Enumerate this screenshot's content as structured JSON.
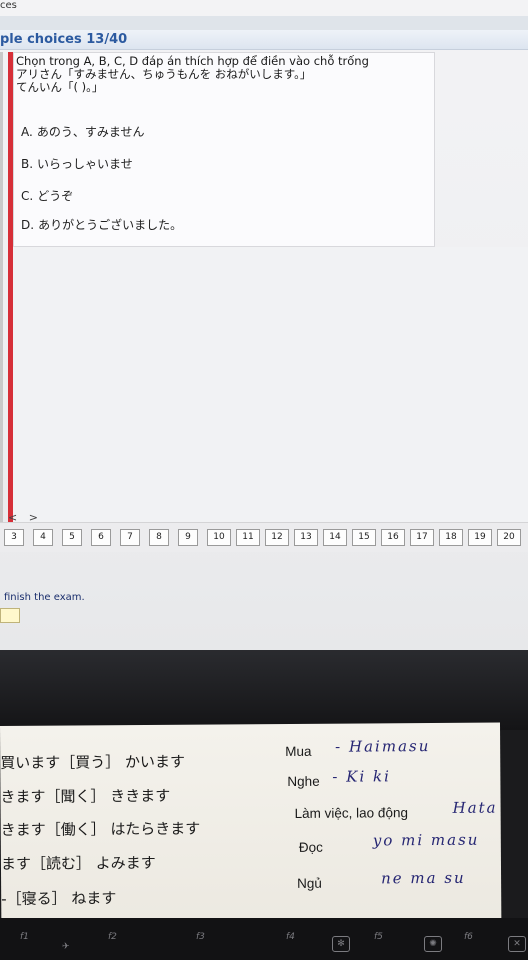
{
  "browser": {
    "tab_fragment": "ces"
  },
  "header": {
    "title": "ple choices 13/40"
  },
  "question": {
    "prompt": "Chọn trong A, B, C, D đáp án thích hợp để điền vào chỗ trống",
    "line2": "アリさん「すみません、ちゅうもんを おねがいします。」",
    "line3": "てんいん「(        )。」",
    "options": [
      {
        "key": "A.",
        "text": "あのう、すみません"
      },
      {
        "key": "B.",
        "text": "いらっしゃいませ"
      },
      {
        "key": "C.",
        "text": "どうぞ"
      },
      {
        "key": "D.",
        "text": "ありがとうございました。"
      }
    ]
  },
  "nav": {
    "arrows": "< >"
  },
  "pager": {
    "pages": [
      "3",
      "4",
      "5",
      "6",
      "7",
      "8",
      "9",
      "10",
      "11",
      "12",
      "13",
      "14",
      "15",
      "16",
      "17",
      "18",
      "19",
      "20"
    ]
  },
  "footer": {
    "finish_text": "finish the exam."
  },
  "note": {
    "rows": [
      {
        "jp": "買います［買う］ かいます",
        "vn": "Mua",
        "hw": "- Haimasu"
      },
      {
        "jp": "きます［聞く］ ききます",
        "vn": "Nghe",
        "hw": "- Ki ki"
      },
      {
        "jp": "きます［働く］ はたらきます",
        "vn": "Làm việc, lao động",
        "hw": "Hata"
      },
      {
        "jp": "ます［読む］ よみます",
        "vn": "Đọc",
        "hw": "yo mi masu"
      },
      {
        "jp": "-［寝る］ ねます",
        "vn": "Ngủ",
        "hw": "ne ma su"
      }
    ]
  },
  "keyboard": {
    "fkeys": [
      "f1",
      "f2",
      "f3",
      "f4",
      "f5",
      "f6"
    ]
  }
}
